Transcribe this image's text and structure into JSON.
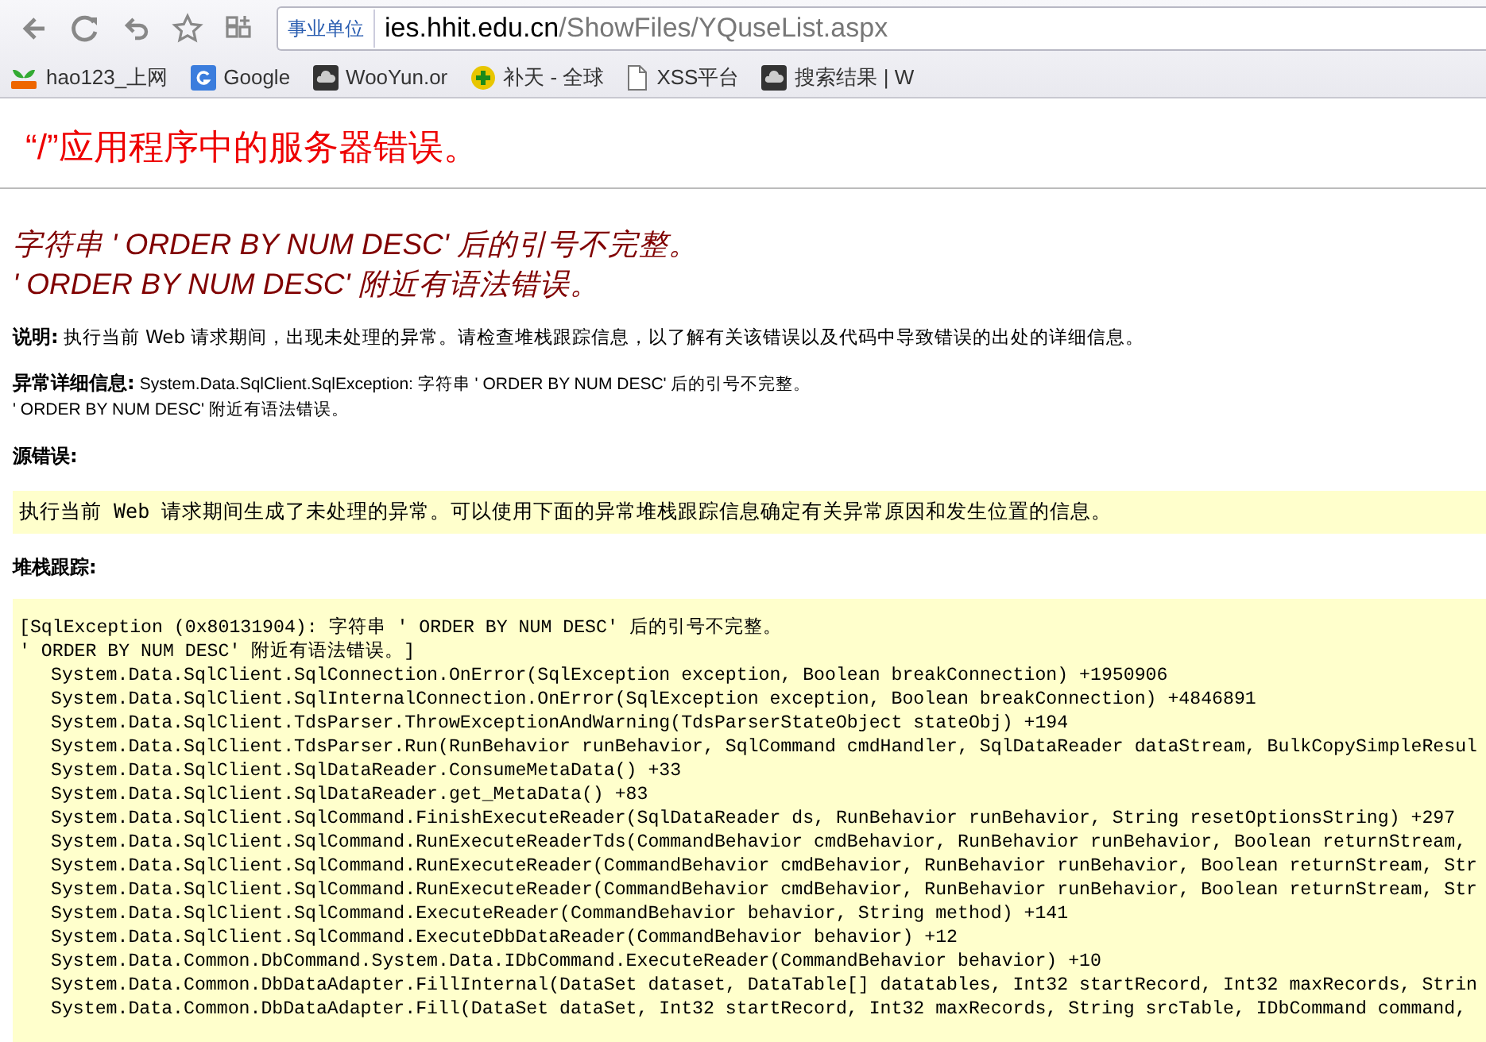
{
  "browser": {
    "address": {
      "badge": "事业单位",
      "host": "ies.hhit.edu.cn",
      "path": "/ShowFiles/YQuseList.aspx"
    },
    "bookmarks": [
      {
        "kind": "hao",
        "label": "hao123_上网"
      },
      {
        "kind": "google",
        "label": "Google"
      },
      {
        "kind": "cloud",
        "label": "WooYun.or"
      },
      {
        "kind": "plus",
        "label": "补天 - 全球"
      },
      {
        "kind": "page",
        "label": "XSS平台"
      },
      {
        "kind": "cloud",
        "label": "搜索结果 | W"
      }
    ]
  },
  "page": {
    "title": "“/”应用程序中的服务器错误。",
    "error_lines": [
      "字符串 ' ORDER BY NUM DESC' 后的引号不完整。",
      "' ORDER BY NUM DESC' 附近有语法错误。"
    ],
    "description": {
      "label": "说明:",
      "text": "执行当前 Web 请求期间，出现未处理的异常。请检查堆栈跟踪信息，以了解有关该错误以及代码中导致错误的出处的详细信息。"
    },
    "exception_details": {
      "label": "异常详细信息:",
      "lines": [
        "System.Data.SqlClient.SqlException: 字符串 ' ORDER BY NUM DESC' 后的引号不完整。",
        "' ORDER BY NUM DESC' 附近有语法错误。"
      ]
    },
    "source_error": {
      "label": "源错误:",
      "text": "执行当前 Web 请求期间生成了未处理的异常。可以使用下面的异常堆栈跟踪信息确定有关异常原因和发生位置的信息。"
    },
    "stack_trace": {
      "label": "堆栈跟踪:",
      "lines": [
        {
          "kind": "message",
          "text": "[SqlException (0x80131904): 字符串 ' ORDER BY NUM DESC' 后的引号不完整。"
        },
        {
          "kind": "message",
          "text": "' ORDER BY NUM DESC' 附近有语法错误。]"
        },
        {
          "kind": "frame",
          "text": "System.Data.SqlClient.SqlConnection.OnError(SqlException exception, Boolean breakConnection) +1950906"
        },
        {
          "kind": "frame",
          "text": "System.Data.SqlClient.SqlInternalConnection.OnError(SqlException exception, Boolean breakConnection) +4846891"
        },
        {
          "kind": "frame",
          "text": "System.Data.SqlClient.TdsParser.ThrowExceptionAndWarning(TdsParserStateObject stateObj) +194"
        },
        {
          "kind": "frame",
          "text": "System.Data.SqlClient.TdsParser.Run(RunBehavior runBehavior, SqlCommand cmdHandler, SqlDataReader dataStream, BulkCopySimpleResul"
        },
        {
          "kind": "frame",
          "text": "System.Data.SqlClient.SqlDataReader.ConsumeMetaData() +33"
        },
        {
          "kind": "frame",
          "text": "System.Data.SqlClient.SqlDataReader.get_MetaData() +83"
        },
        {
          "kind": "frame",
          "text": "System.Data.SqlClient.SqlCommand.FinishExecuteReader(SqlDataReader ds, RunBehavior runBehavior, String resetOptionsString) +297"
        },
        {
          "kind": "frame",
          "text": "System.Data.SqlClient.SqlCommand.RunExecuteReaderTds(CommandBehavior cmdBehavior, RunBehavior runBehavior, Boolean returnStream,"
        },
        {
          "kind": "frame",
          "text": "System.Data.SqlClient.SqlCommand.RunExecuteReader(CommandBehavior cmdBehavior, RunBehavior runBehavior, Boolean returnStream, Str"
        },
        {
          "kind": "frame",
          "text": "System.Data.SqlClient.SqlCommand.RunExecuteReader(CommandBehavior cmdBehavior, RunBehavior runBehavior, Boolean returnStream, Str"
        },
        {
          "kind": "frame",
          "text": "System.Data.SqlClient.SqlCommand.ExecuteReader(CommandBehavior behavior, String method) +141"
        },
        {
          "kind": "frame",
          "text": "System.Data.SqlClient.SqlCommand.ExecuteDbDataReader(CommandBehavior behavior) +12"
        },
        {
          "kind": "frame",
          "text": "System.Data.Common.DbCommand.System.Data.IDbCommand.ExecuteReader(CommandBehavior behavior) +10"
        },
        {
          "kind": "frame",
          "text": "System.Data.Common.DbDataAdapter.FillInternal(DataSet dataset, DataTable[] datatables, Int32 startRecord, Int32 maxRecords, Strin"
        },
        {
          "kind": "frame",
          "text": "System.Data.Common.DbDataAdapter.Fill(DataSet dataSet, Int32 startRecord, Int32 maxRecords, String srcTable, IDbCommand command, "
        }
      ]
    }
  }
}
